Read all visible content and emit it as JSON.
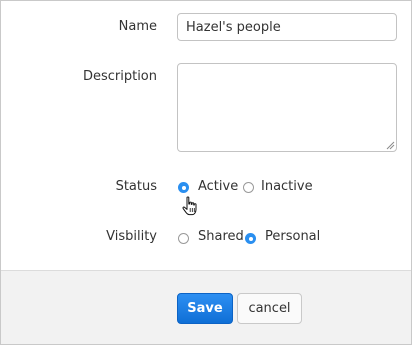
{
  "form": {
    "name": {
      "label": "Name",
      "value": "Hazel's people"
    },
    "description": {
      "label": "Description",
      "value": ""
    },
    "status": {
      "label": "Status",
      "options": [
        {
          "label": "Active",
          "checked": true
        },
        {
          "label": "Inactive",
          "checked": false
        }
      ]
    },
    "visibility": {
      "label": "Visbility",
      "options": [
        {
          "label": "Shared",
          "checked": false
        },
        {
          "label": "Personal",
          "checked": true
        }
      ]
    }
  },
  "footer": {
    "save_label": "Save",
    "cancel_label": "cancel"
  },
  "colors": {
    "accent": "#2a8ff0",
    "footer_bg": "#f2f2f2"
  },
  "icons": {
    "cursor": "hand-pointer-icon",
    "grip": "resize-grip-icon"
  }
}
